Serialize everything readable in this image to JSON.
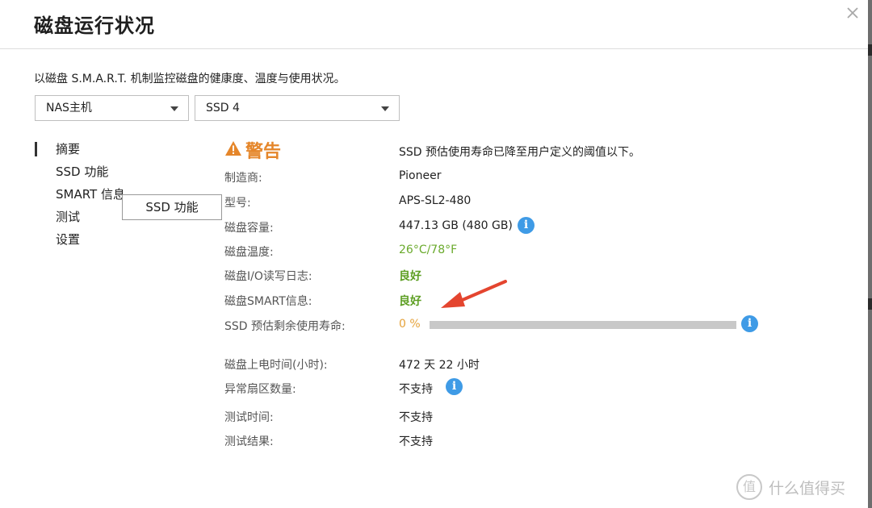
{
  "dialog": {
    "title": "磁盘运行状况",
    "description": "以磁盘 S.M.A.R.T. 机制监控磁盘的健康度、温度与使用状况。"
  },
  "selectors": {
    "host": "NAS主机",
    "disk": "SSD 4"
  },
  "nav": {
    "items": [
      "摘要",
      "SSD 功能",
      "SMART 信息",
      "测试",
      "设置"
    ],
    "active_index": 0,
    "tooltip": "SSD 功能"
  },
  "status": {
    "label": "警告",
    "message": "SSD 预估使用寿命已降至用户定义的阈值以下。"
  },
  "fields": {
    "manufacturer": {
      "label": "制造商:",
      "value": "Pioneer"
    },
    "model": {
      "label": "型号:",
      "value": "APS-SL2-480"
    },
    "capacity": {
      "label": "磁盘容量:",
      "value": "447.13 GB (480 GB)"
    },
    "temperature": {
      "label": "磁盘温度:",
      "value": "26°C/78°F"
    },
    "io_log": {
      "label": "磁盘I/O读写日志:",
      "value": "良好"
    },
    "smart": {
      "label": "磁盘SMART信息:",
      "value": "良好"
    },
    "life": {
      "label": "SSD 预估剩余使用寿命:",
      "value": "0 %",
      "percent": 0
    },
    "power_on": {
      "label": "磁盘上电时间(小时):",
      "value": "472 天 22 小时"
    },
    "bad_sectors": {
      "label": "异常扇区数量:",
      "value": "不支持"
    },
    "test_time": {
      "label": "测试时间:",
      "value": "不支持"
    },
    "test_result": {
      "label": "测试结果:",
      "value": "不支持"
    }
  },
  "icons": {
    "info": "i"
  },
  "watermark": {
    "mark": "值",
    "text": "什么值得买"
  },
  "colors": {
    "warning": "#e5862a",
    "good": "#5e9f24",
    "temperature": "#6aaa2c",
    "life": "#e5a23a",
    "info": "#3f9be6",
    "annotation_arrow": "#e4452f"
  }
}
